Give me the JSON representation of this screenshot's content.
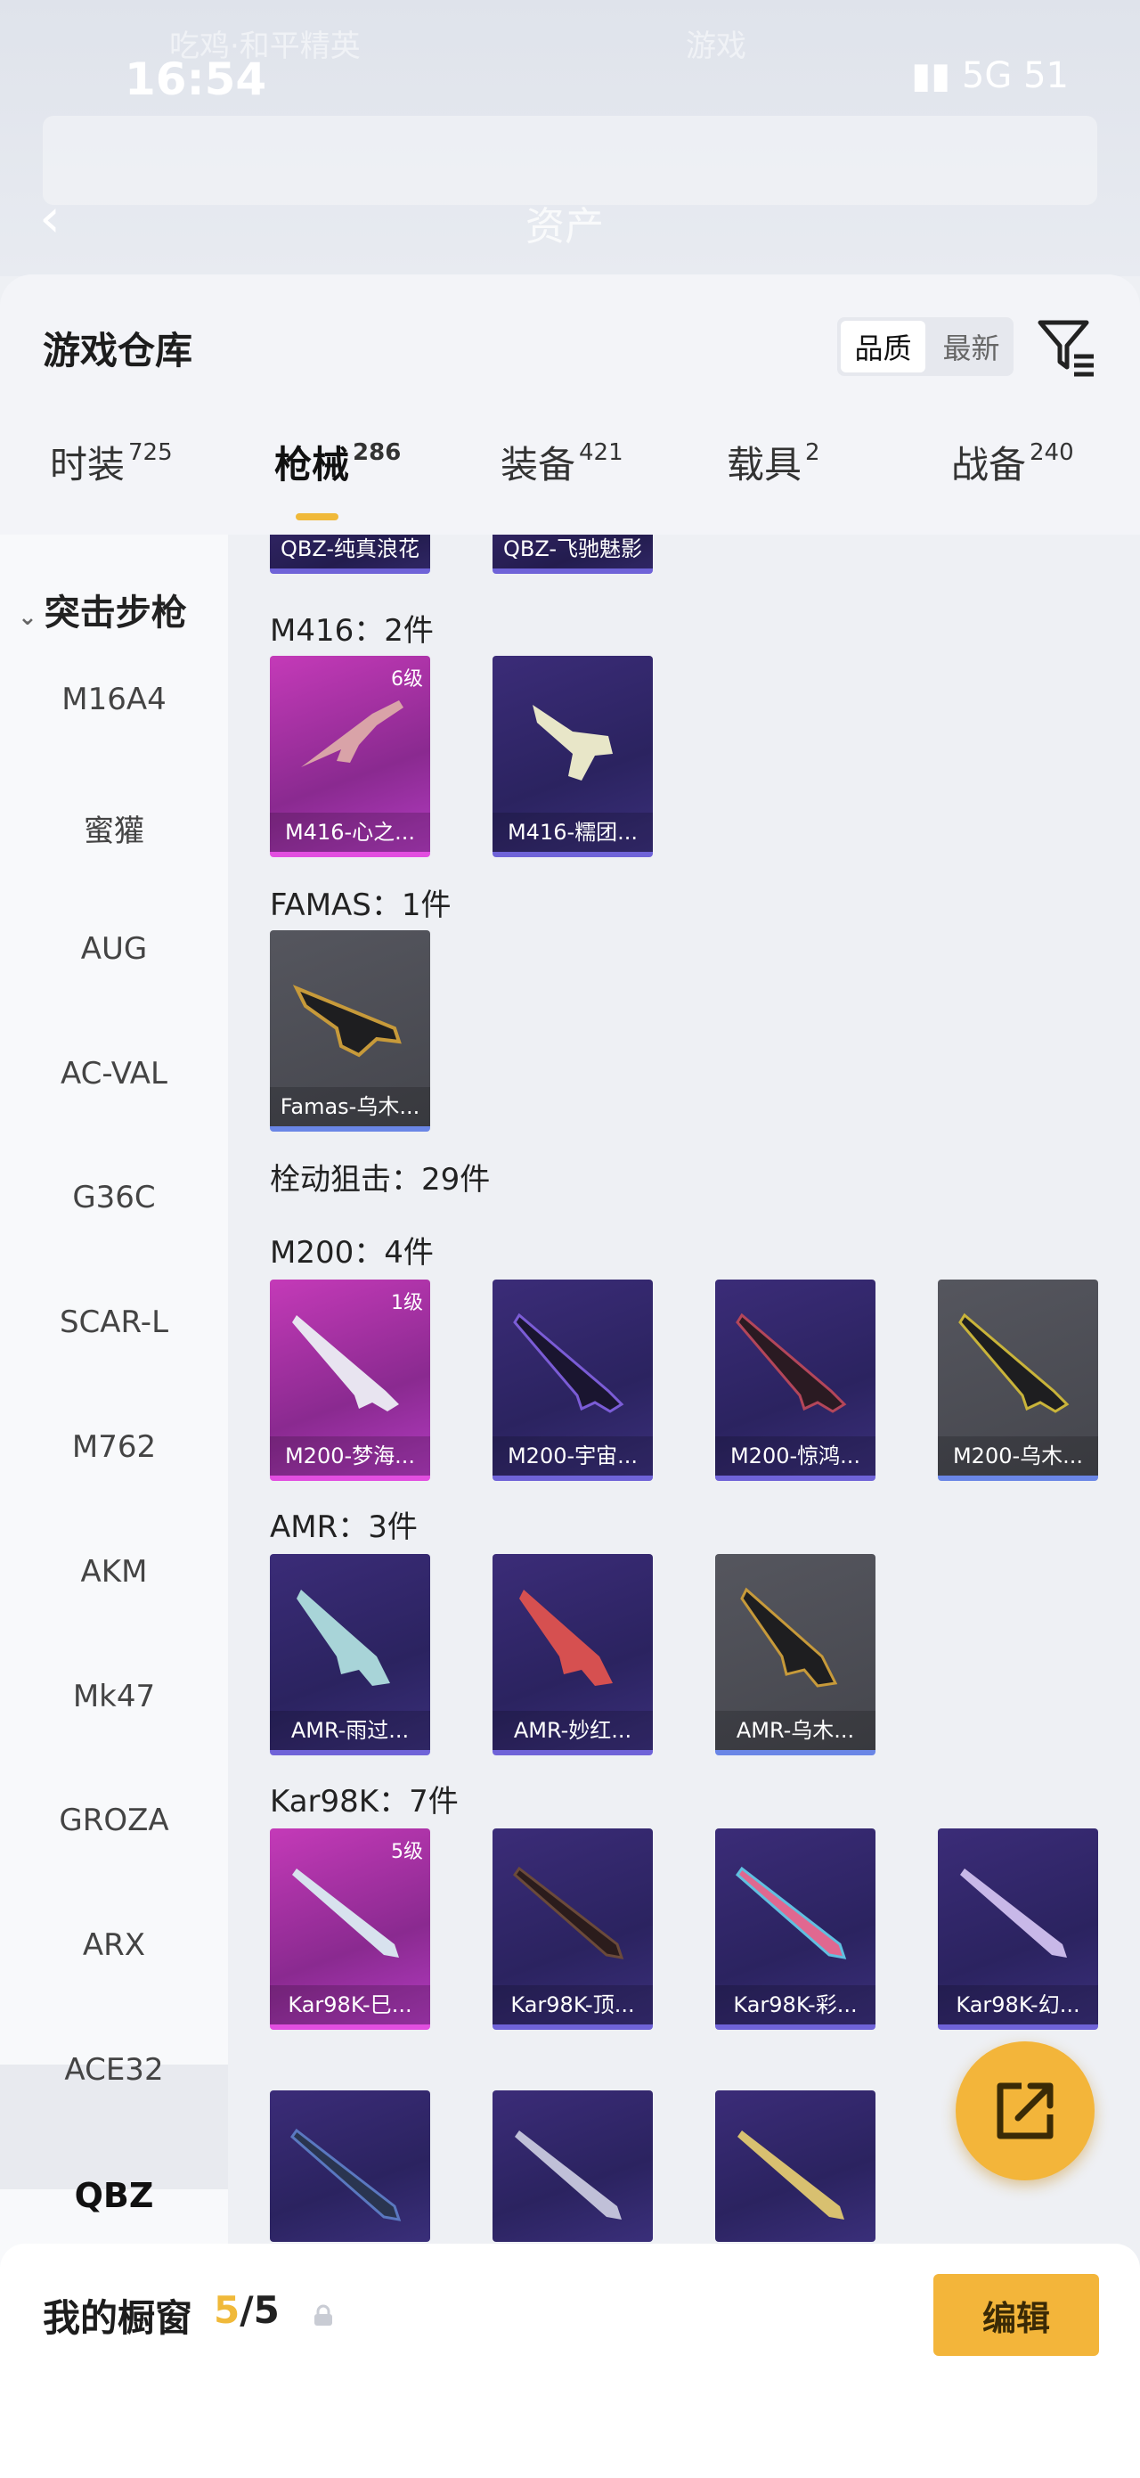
{
  "status_bar": {
    "time": "16:54",
    "network": "5G",
    "battery": "51"
  },
  "background_header": {
    "left_title": "吃鸡·和平精英",
    "right_title": "游戏",
    "center_label": "资产"
  },
  "sheet": {
    "title": "游戏仓库",
    "sort_options": [
      "品质",
      "最新"
    ],
    "tabs": [
      {
        "label": "时装",
        "count": "725"
      },
      {
        "label": "枪械",
        "count": "286"
      },
      {
        "label": "装备",
        "count": "421"
      },
      {
        "label": "载具",
        "count": "2"
      },
      {
        "label": "战备",
        "count": "240"
      }
    ]
  },
  "sidebar": {
    "section": "突击步枪",
    "items": [
      "M16A4",
      "蜜獾",
      "AUG",
      "AC-VAL",
      "G36C",
      "SCAR-L",
      "M762",
      "AKM",
      "Mk47",
      "GROZA",
      "ARX",
      "ACE32",
      "QBZ"
    ]
  },
  "content": {
    "top_partial": [
      "QBZ-纯真浪花",
      "QBZ-飞驰魅影"
    ],
    "groups": [
      {
        "label": "M416：2件",
        "items": [
          {
            "name": "M416-心之...",
            "level": "6级"
          },
          {
            "name": "M416-糯团..."
          }
        ]
      },
      {
        "label": "FAMAS：1件",
        "items": [
          {
            "name": "Famas-乌木..."
          }
        ]
      },
      {
        "category": "栓动狙击：29件"
      },
      {
        "label": "M200：4件",
        "items": [
          {
            "name": "M200-梦海...",
            "level": "1级"
          },
          {
            "name": "M200-宇宙..."
          },
          {
            "name": "M200-惊鸿..."
          },
          {
            "name": "M200-乌木..."
          }
        ]
      },
      {
        "label": "AMR：3件",
        "items": [
          {
            "name": "AMR-雨过..."
          },
          {
            "name": "AMR-妙红..."
          },
          {
            "name": "AMR-乌木..."
          }
        ]
      },
      {
        "label": "Kar98K：7件",
        "items": [
          {
            "name": "Kar98K-巳...",
            "level": "5级"
          },
          {
            "name": "Kar98K-顶..."
          },
          {
            "name": "Kar98K-彩..."
          },
          {
            "name": "Kar98K-幻..."
          }
        ]
      }
    ]
  },
  "showcase": {
    "title": "我的橱窗",
    "current": "5",
    "total": "/5",
    "edit_label": "编辑"
  },
  "colors": {
    "accent": "#f3b53a",
    "legend_purple": "#3b2c78",
    "epic_pink": "#c43ab8",
    "gray_rare": "#55565e"
  },
  "icons": [
    "back-icon",
    "filter-icon",
    "chevron-down-icon",
    "lock-icon",
    "share-icon",
    "gun-icon"
  ]
}
